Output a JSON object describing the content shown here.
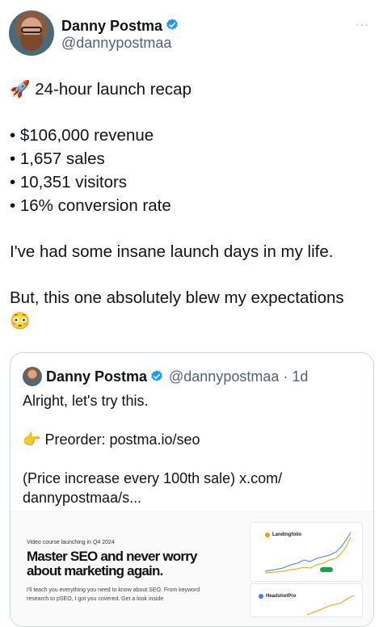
{
  "author": {
    "name": "Danny Postma",
    "handle": "@dannypostmaa",
    "verified_color": "#1d9bf0",
    "more_label": "···"
  },
  "tweet": {
    "line1_emoji": "🚀",
    "line1": "24-hour launch recap",
    "stats": [
      "• $106,000 revenue",
      "• 1,657 sales",
      "• 10,351 visitors",
      "• 16% conversion rate"
    ],
    "para2": "I've had some insane launch days in my life.",
    "para3": "But, this one absolutely blew my expectations",
    "para3_emoji": "😳"
  },
  "quote": {
    "name": "Danny Postma",
    "handle_time": "@dannypostmaa · 1d",
    "line1": "Alright, let's try this.",
    "line2_emoji": "👉",
    "line2": "Preorder: postma.io/seo",
    "line3": "(Price increase every 100th sale) x.com/ dannypostmaa/s..."
  },
  "media": {
    "kicker": "Video course launching in Q4 2024",
    "headline": "Master SEO and never worry about marketing again.",
    "sub": "I'll teach you everything you need to know about SEO. From keyword research to pSEO, I got you covered. Get a look inside",
    "card1_label": "Landingfolio",
    "card2_label": "HeadshotPro",
    "line_colors": [
      "#3b82f6",
      "#f59e0b"
    ]
  }
}
